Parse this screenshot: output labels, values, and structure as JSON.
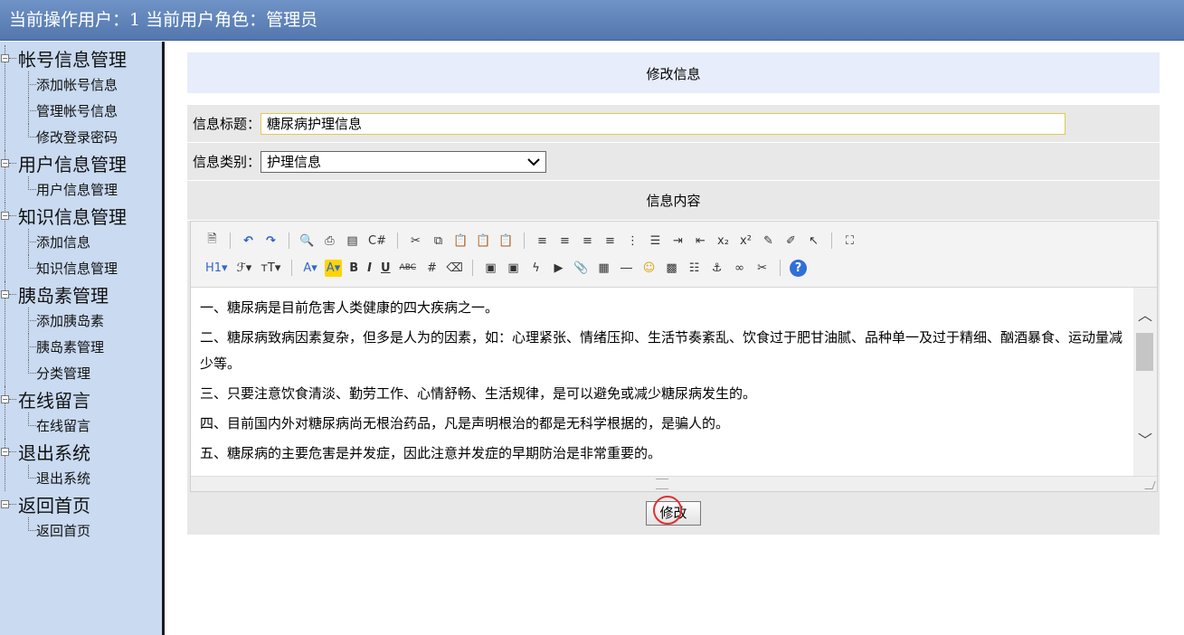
{
  "topbar": {
    "title": "当前操作用户：1 当前用户角色：管理员"
  },
  "sidebar": {
    "groups": [
      {
        "label": "帐号信息管理",
        "items": [
          "添加帐号信息",
          "管理帐号信息",
          "修改登录密码"
        ]
      },
      {
        "label": "用户信息管理",
        "items": [
          "用户信息管理"
        ]
      },
      {
        "label": "知识信息管理",
        "items": [
          "添加信息",
          "知识信息管理"
        ]
      },
      {
        "label": "胰岛素管理",
        "items": [
          "添加胰岛素",
          "胰岛素管理",
          "分类管理"
        ]
      },
      {
        "label": "在线留言",
        "items": [
          "在线留言"
        ]
      },
      {
        "label": "退出系统",
        "items": [
          "退出系统"
        ]
      },
      {
        "label": "返回首页",
        "items": [
          "返回首页"
        ]
      }
    ]
  },
  "form": {
    "header": "修改信息",
    "title_label": "信息标题：",
    "title_value": "糖尿病护理信息",
    "category_label": "信息类别：",
    "category_value": "护理信息",
    "content_label": "信息内容",
    "submit_label": "修改"
  },
  "editor": {
    "paragraphs": [
      "一、糖尿病是目前危害人类健康的四大疾病之一。",
      "二、糖尿病致病因素复杂，但多是人为的因素，如：心理紧张、情绪压抑、生活节奏紊乱、饮食过于肥甘油腻、品种单一及过于精细、酗酒暴食、运动量减少等。",
      "三、只要注意饮食清淡、勤劳工作、心情舒畅、生活规律，是可以避免或减少糖尿病发生的。",
      "四、目前国内外对糖尿病尚无根治药品，凡是声明根治的都是无科学根据的，是骗人的。",
      "五、糖尿病的主要危害是并发症，因此注意并发症的早期防治是非常重要的。"
    ],
    "toolbar_row1": [
      "source-icon",
      "undo-icon",
      "redo-icon",
      "preview-icon",
      "print-icon",
      "template-icon",
      "code-icon",
      "cut-icon",
      "copy-icon",
      "paste-icon",
      "paste-text-icon",
      "paste-word-icon",
      "align-left-icon",
      "align-center-icon",
      "align-right-icon",
      "justify-icon",
      "ordered-list-icon",
      "unordered-list-icon",
      "indent-icon",
      "outdent-icon",
      "subscript-icon",
      "superscript-icon",
      "clear-format-icon",
      "select-all-icon",
      "pointer-icon",
      "fullscreen-icon"
    ],
    "toolbar_row2": [
      "heading-icon",
      "font-family-icon",
      "font-size-icon",
      "font-color-icon",
      "highlight-icon",
      "bold-icon",
      "italic-icon",
      "underline-icon",
      "strikethrough-icon",
      "line-height-icon",
      "eraser-icon",
      "image-icon",
      "multi-image-icon",
      "flash-icon",
      "media-icon",
      "attachment-icon",
      "table-icon",
      "hr-icon",
      "emoticon-icon",
      "map-icon",
      "pagebreak-icon",
      "anchor-icon",
      "link-icon",
      "unlink-icon",
      "help-icon"
    ],
    "tb_glyphs": {
      "heading": "H1▾",
      "font_family": "ℱ▾",
      "font_size": "тT▾",
      "font_color": "A▾",
      "highlight": "A▾",
      "bold": "B",
      "italic": "I",
      "underline": "U",
      "strike": "ABC"
    }
  }
}
